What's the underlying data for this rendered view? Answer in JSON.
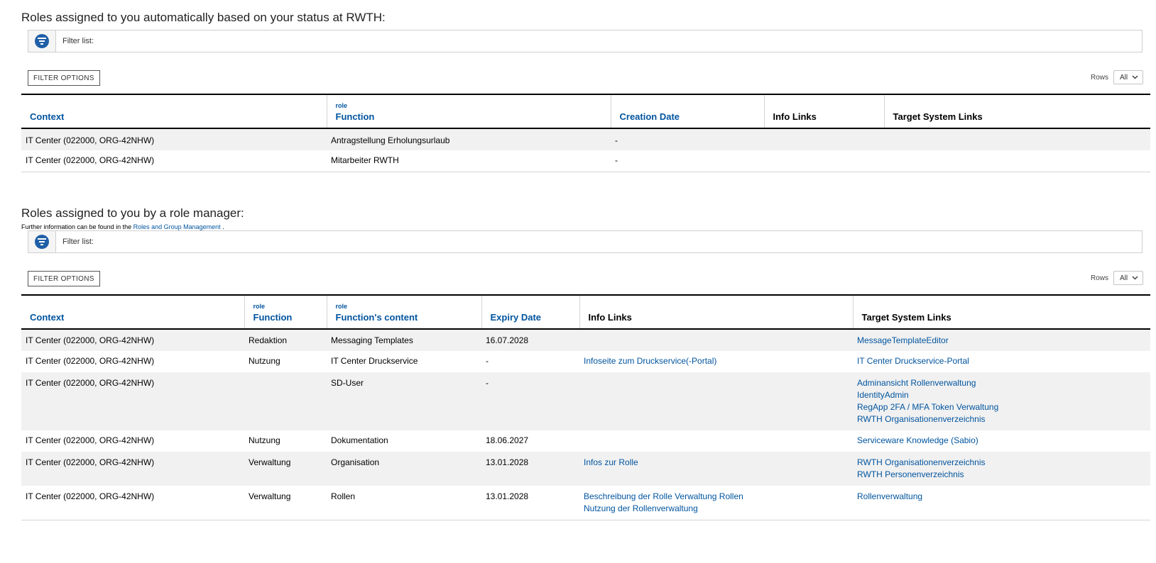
{
  "section1": {
    "heading": "Roles assigned to you automatically based on your status at RWTH:",
    "filter_label": "Filter list:",
    "filter_options_label": "FILTER OPTIONS",
    "rows_label": "Rows",
    "rows_value": "All",
    "columns": [
      {
        "sub": "",
        "label": "Context"
      },
      {
        "sub": "role",
        "label": "Function"
      },
      {
        "sub": "",
        "label": "Creation Date"
      },
      {
        "sub": "",
        "label": "Info Links"
      },
      {
        "sub": "",
        "label": "Target System Links"
      }
    ],
    "rows": [
      {
        "context": "IT Center (022000, ORG-42NHW)",
        "function": "Antragstellung Erholungsurlaub",
        "creation_date": "-"
      },
      {
        "context": "IT Center (022000, ORG-42NHW)",
        "function": "Mitarbeiter RWTH",
        "creation_date": "-"
      }
    ]
  },
  "section2": {
    "heading": "Roles assigned to you by a role manager:",
    "info_prefix": "Further information can be found in the",
    "info_link": "Roles and Group Management",
    "info_suffix": ".",
    "filter_label": "Filter list:",
    "filter_options_label": "FILTER OPTIONS",
    "rows_label": "Rows",
    "rows_value": "All",
    "columns": [
      {
        "sub": "",
        "label": "Context"
      },
      {
        "sub": "role",
        "label": "Function"
      },
      {
        "sub": "role",
        "label": "Function's content"
      },
      {
        "sub": "",
        "label": "Expiry Date"
      },
      {
        "sub": "",
        "label": "Info Links"
      },
      {
        "sub": "",
        "label": "Target System Links"
      }
    ],
    "rows": [
      {
        "context": "IT Center (022000, ORG-42NHW)",
        "function": "Redaktion",
        "content": "Messaging Templates",
        "expiry": "16.07.2028",
        "info_links": [],
        "target_links": [
          "MessageTemplateEditor"
        ]
      },
      {
        "context": "IT Center (022000, ORG-42NHW)",
        "function": "Nutzung",
        "content": "IT Center Druckservice",
        "expiry": "-",
        "info_links": [
          "Infoseite zum Druckservice(-Portal)"
        ],
        "target_links": [
          "IT Center Druckservice-Portal"
        ]
      },
      {
        "context": "IT Center (022000, ORG-42NHW)",
        "function": "",
        "content": "SD-User",
        "expiry": "-",
        "info_links": [],
        "target_links": [
          "Adminansicht Rollenverwaltung",
          "IdentityAdmin",
          "RegApp 2FA / MFA Token Verwaltung",
          "RWTH Organisationenverzeichnis"
        ]
      },
      {
        "context": "IT Center (022000, ORG-42NHW)",
        "function": "Nutzung",
        "content": "Dokumentation",
        "expiry": "18.06.2027",
        "info_links": [],
        "target_links": [
          "Serviceware Knowledge (Sabio)"
        ]
      },
      {
        "context": "IT Center (022000, ORG-42NHW)",
        "function": "Verwaltung",
        "content": "Organisation",
        "expiry": "13.01.2028",
        "info_links": [
          "Infos zur Rolle"
        ],
        "target_links": [
          "RWTH Organisationenverzeichnis",
          "RWTH Personenverzeichnis"
        ]
      },
      {
        "context": "IT Center (022000, ORG-42NHW)",
        "function": "Verwaltung",
        "content": "Rollen",
        "expiry": "13.01.2028",
        "info_links": [
          "Beschreibung der Rolle Verwaltung Rollen",
          "Nutzung der Rollenverwaltung"
        ],
        "target_links": [
          "Rollenverwaltung"
        ]
      }
    ]
  }
}
